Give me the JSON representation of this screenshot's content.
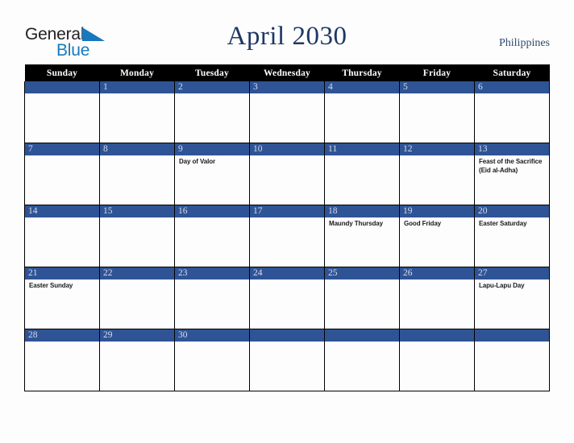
{
  "brand": {
    "name_part1": "General",
    "name_part2": "Blue"
  },
  "header": {
    "title": "April 2030",
    "country": "Philippines"
  },
  "calendar": {
    "weekday_headers": [
      "Sunday",
      "Monday",
      "Tuesday",
      "Wednesday",
      "Thursday",
      "Friday",
      "Saturday"
    ],
    "colors": {
      "header_bar": "#000000",
      "day_bar": "#2f5496",
      "title": "#1f3864",
      "brand_blue": "#1878be"
    },
    "weeks": [
      [
        {
          "date": "",
          "events": []
        },
        {
          "date": "1",
          "events": []
        },
        {
          "date": "2",
          "events": []
        },
        {
          "date": "3",
          "events": []
        },
        {
          "date": "4",
          "events": []
        },
        {
          "date": "5",
          "events": []
        },
        {
          "date": "6",
          "events": []
        }
      ],
      [
        {
          "date": "7",
          "events": []
        },
        {
          "date": "8",
          "events": []
        },
        {
          "date": "9",
          "events": [
            "Day of Valor"
          ]
        },
        {
          "date": "10",
          "events": []
        },
        {
          "date": "11",
          "events": []
        },
        {
          "date": "12",
          "events": []
        },
        {
          "date": "13",
          "events": [
            "Feast of the Sacrifice (Eid al-Adha)"
          ]
        }
      ],
      [
        {
          "date": "14",
          "events": []
        },
        {
          "date": "15",
          "events": []
        },
        {
          "date": "16",
          "events": []
        },
        {
          "date": "17",
          "events": []
        },
        {
          "date": "18",
          "events": [
            "Maundy Thursday"
          ]
        },
        {
          "date": "19",
          "events": [
            "Good Friday"
          ]
        },
        {
          "date": "20",
          "events": [
            "Easter Saturday"
          ]
        }
      ],
      [
        {
          "date": "21",
          "events": [
            "Easter Sunday"
          ]
        },
        {
          "date": "22",
          "events": []
        },
        {
          "date": "23",
          "events": []
        },
        {
          "date": "24",
          "events": []
        },
        {
          "date": "25",
          "events": []
        },
        {
          "date": "26",
          "events": []
        },
        {
          "date": "27",
          "events": [
            "Lapu-Lapu Day"
          ]
        }
      ],
      [
        {
          "date": "28",
          "events": []
        },
        {
          "date": "29",
          "events": []
        },
        {
          "date": "30",
          "events": []
        },
        {
          "date": "",
          "events": []
        },
        {
          "date": "",
          "events": []
        },
        {
          "date": "",
          "events": []
        },
        {
          "date": "",
          "events": []
        }
      ]
    ]
  }
}
